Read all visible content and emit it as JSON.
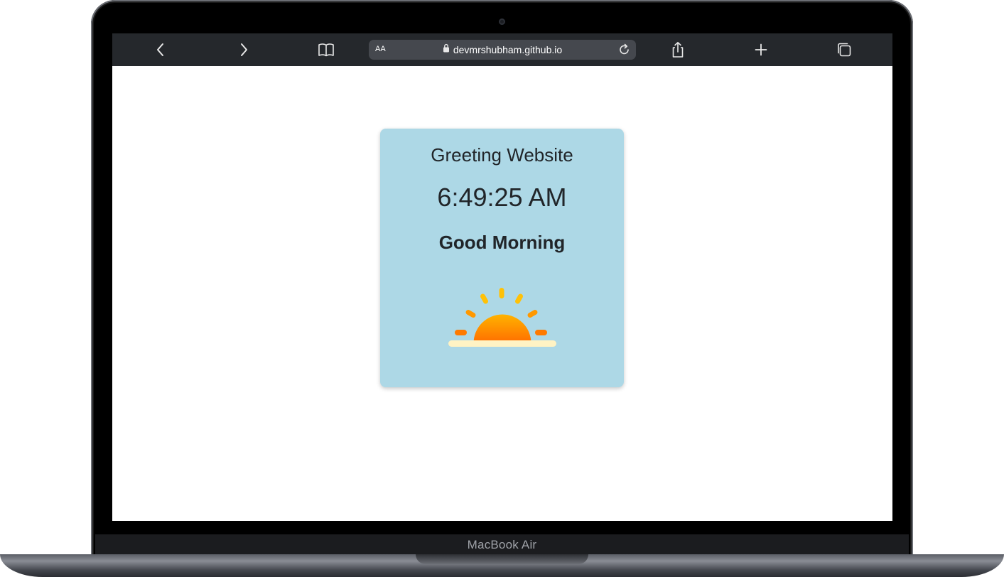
{
  "device": {
    "label": "MacBook Air"
  },
  "browser": {
    "text_size_label": "AA",
    "url": "devmrshubham.github.io",
    "icons": {
      "back": "chevron-left-icon",
      "forward": "chevron-right-icon",
      "bookmarks": "book-icon",
      "lock": "lock-icon",
      "reload": "reload-icon",
      "share": "share-icon",
      "new_tab": "plus-icon",
      "tabs": "tabs-icon"
    }
  },
  "card": {
    "title": "Greeting Website",
    "time": "6:49:25 AM",
    "greeting": "Good Morning",
    "image_icon": "sunrise-icon"
  },
  "colors": {
    "card_background": "#add8e6",
    "toolbar_background": "#25282c",
    "sun_top": "#ffb300",
    "sun_bottom": "#ff6d00"
  }
}
